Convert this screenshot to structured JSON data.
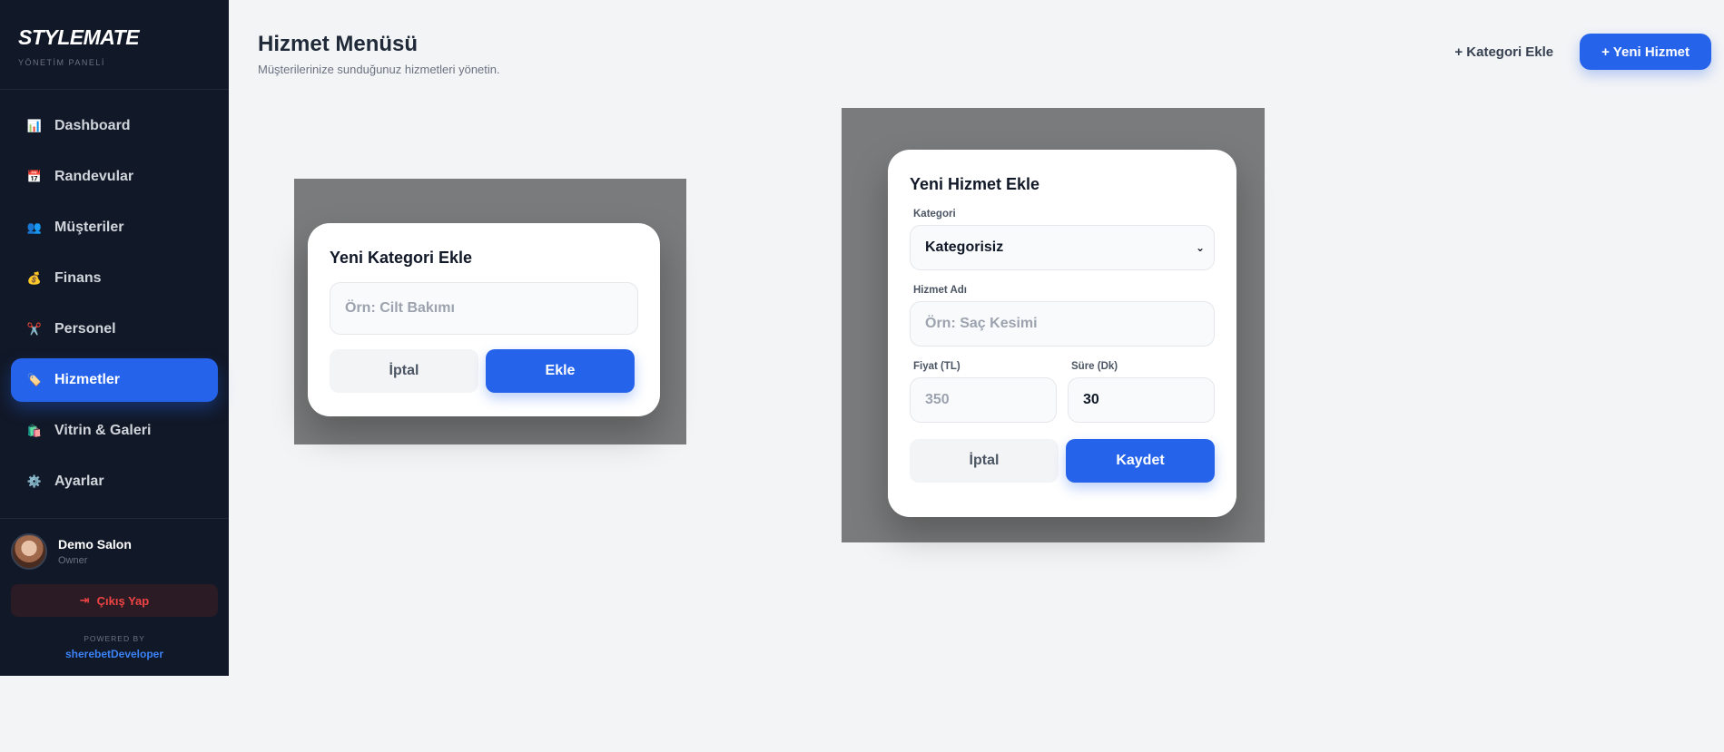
{
  "brand": {
    "title": "STYLEMATE",
    "subtitle": "YÖNETİM PANELİ"
  },
  "sidebar": {
    "items": [
      {
        "label": "Dashboard",
        "icon": "📊"
      },
      {
        "label": "Randevular",
        "icon": "📅"
      },
      {
        "label": "Müşteriler",
        "icon": "👥"
      },
      {
        "label": "Finans",
        "icon": "💰"
      },
      {
        "label": "Personel",
        "icon": "✂️"
      },
      {
        "label": "Hizmetler",
        "icon": "🏷️"
      },
      {
        "label": "Vitrin & Galeri",
        "icon": "🛍️"
      },
      {
        "label": "Ayarlar",
        "icon": "⚙️"
      }
    ],
    "active_index": 5
  },
  "profile": {
    "name": "Demo Salon",
    "role": "Owner"
  },
  "logout": {
    "label": "Çıkış Yap",
    "icon": "⇥"
  },
  "footer": {
    "powered": "POWERED BY",
    "developer": "sherebetDeveloper"
  },
  "header": {
    "title": "Hizmet Menüsü",
    "subtitle": "Müşterilerinize sunduğunuz hizmetleri yönetin.",
    "add_category": "+ Kategori Ekle",
    "new_service": "+ Yeni Hizmet"
  },
  "category_modal": {
    "title": "Yeni Kategori Ekle",
    "input_placeholder": "Örn: Cilt Bakımı",
    "cancel": "İptal",
    "submit": "Ekle"
  },
  "service_modal": {
    "title": "Yeni Hizmet Ekle",
    "category_label": "Kategori",
    "category_value": "Kategorisiz",
    "name_label": "Hizmet Adı",
    "name_placeholder": "Örn: Saç Kesimi",
    "price_label": "Fiyat (TL)",
    "price_placeholder": "350",
    "duration_label": "Süre (Dk)",
    "duration_value": "30",
    "cancel": "İptal",
    "submit": "Kaydet"
  },
  "colors": {
    "accent": "#2563eb",
    "sidebar_bg": "#111827",
    "danger": "#ef4444"
  }
}
